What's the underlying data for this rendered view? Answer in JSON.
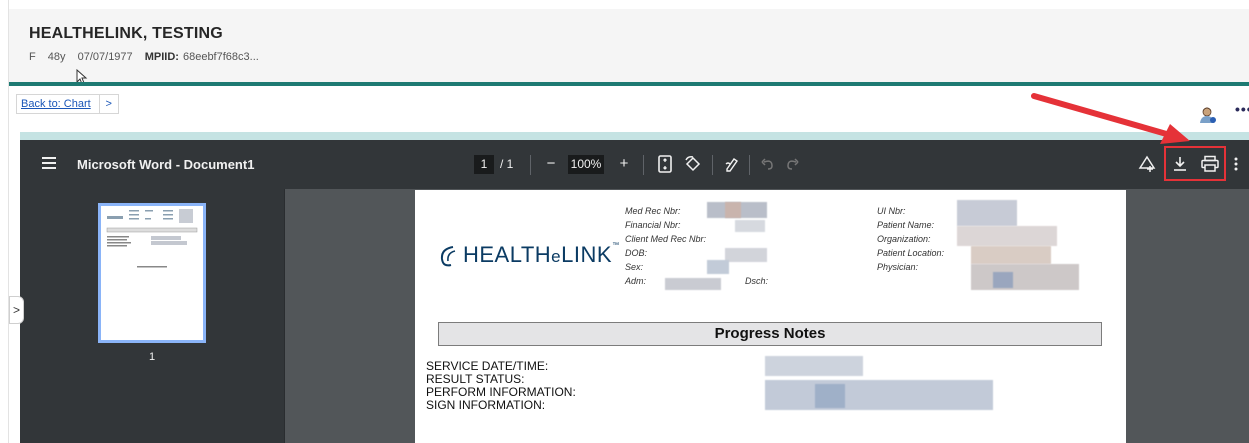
{
  "patient": {
    "name": "HEALTHELINK, TESTING",
    "sex": "F",
    "age": "48y",
    "dob": "07/07/1977",
    "mpiid_label": "MPIID:",
    "mpiid_value": "68eebf7f68c3..."
  },
  "nav": {
    "back_label": "Back to: Chart",
    "chevron": ">",
    "more": "•••"
  },
  "viewer": {
    "title": "Microsoft Word - Document1",
    "page_current": "1",
    "page_total": "/ 1",
    "zoom": "100%",
    "zoom_out": "−",
    "zoom_in": "+",
    "thumbnail_page_label": "1",
    "collapse_chevron": ">"
  },
  "document": {
    "logo_text_prefix": "HEALTH",
    "logo_text_e": "e",
    "logo_text_suffix": "LINK",
    "logo_tm": "™",
    "left_labels": [
      "Med Rec Nbr:",
      "Financial Nbr:",
      "Client Med Rec Nbr:",
      "DOB:",
      "Sex:"
    ],
    "adm_label": "Adm:",
    "dsch_label": "Dsch:",
    "right_labels": [
      "UI Nbr:",
      "Patient Name:",
      "Organization:",
      "Patient Location:",
      "Physician:"
    ],
    "section_title": "Progress Notes",
    "service_labels": [
      "SERVICE DATE/TIME:",
      "RESULT STATUS:",
      "PERFORM INFORMATION:",
      "SIGN INFORMATION:"
    ]
  },
  "colors": {
    "teal": "#1e7a73",
    "light_teal": "#c5e3e3",
    "toolbar_bg": "#323639",
    "annotation_red": "#e53238",
    "link_blue": "#1a56b8"
  },
  "icons": [
    "hamburger-icon",
    "fit-page-icon",
    "rotate-icon",
    "annotate-icon",
    "undo-icon",
    "redo-icon",
    "drive-icon",
    "download-icon",
    "print-icon",
    "more-vert-icon",
    "user-icon"
  ]
}
